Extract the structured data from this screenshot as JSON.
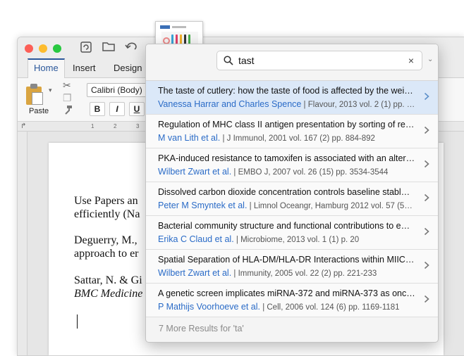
{
  "word": {
    "tabs": [
      "Home",
      "Insert",
      "Design"
    ],
    "active_tab": "Home",
    "paste_label": "Paste",
    "font_name": "Calibri (Body)",
    "format_buttons": [
      "B",
      "I",
      "U"
    ],
    "ruler_marks": [
      "1",
      "2",
      "3"
    ],
    "document_lines": [
      "Use Papers an",
      "efficiently (Na",
      "Deguerry, M.,",
      "approach to er",
      "Sattar, N. & Gi",
      "BMC Medicine"
    ]
  },
  "search": {
    "query": "tast",
    "clear_glyph": "×",
    "dropdown_glyph": "⌄"
  },
  "results": [
    {
      "title": "The taste of cutlery: how the taste of food is affected by the wei…",
      "authors": "Vanessa Harrar and Charles Spence",
      "citation": " | Flavour, 2013 vol. 2 (1) pp. 1-13",
      "selected": true
    },
    {
      "title": "Regulation of MHC class II antigen presentation by sorting of re…",
      "authors": "M van Lith et al.",
      "citation": " | J Immunol, 2001 vol. 167 (2) pp. 884-892",
      "selected": false
    },
    {
      "title": "PKA-induced resistance to tamoxifen is associated with an alter…",
      "authors": "Wilbert Zwart et al.",
      "citation": " | EMBO J, 2007 vol. 26 (15) pp. 3534-3544",
      "selected": false
    },
    {
      "title": "Dissolved carbon dioxide concentration controls baseline stabl…",
      "authors": "Peter M Smyntek et al.",
      "citation": " | Limnol Oceangr, Hamburg 2012 vol. 57 (5…",
      "selected": false
    },
    {
      "title": "Bacterial community structure and functional contributions to e…",
      "authors": "Erika C Claud et al.",
      "citation": " | Microbiome, 2013 vol. 1 (1) p. 20",
      "selected": false
    },
    {
      "title": "Spatial Separation of HLA-DM/HLA-DR Interactions within MIIC…",
      "authors": "Wilbert Zwart et al.",
      "citation": " | Immunity, 2005 vol. 22 (2) pp. 221-233",
      "selected": false
    },
    {
      "title": "A genetic screen implicates miRNA-372 and miRNA-373 as onc…",
      "authors": "P Mathijs Voorhoeve et al.",
      "citation": " | Cell, 2006 vol. 124 (6) pp. 1169-1181",
      "selected": false
    }
  ],
  "more_results": "7 More Results for 'ta'",
  "colors": {
    "accent": "#2b579a",
    "author_link": "#2a6bc7",
    "selected_row": "#dbe8f8",
    "traffic_close": "#fc5f57",
    "traffic_min": "#fdbc2e",
    "traffic_max": "#28c840"
  }
}
